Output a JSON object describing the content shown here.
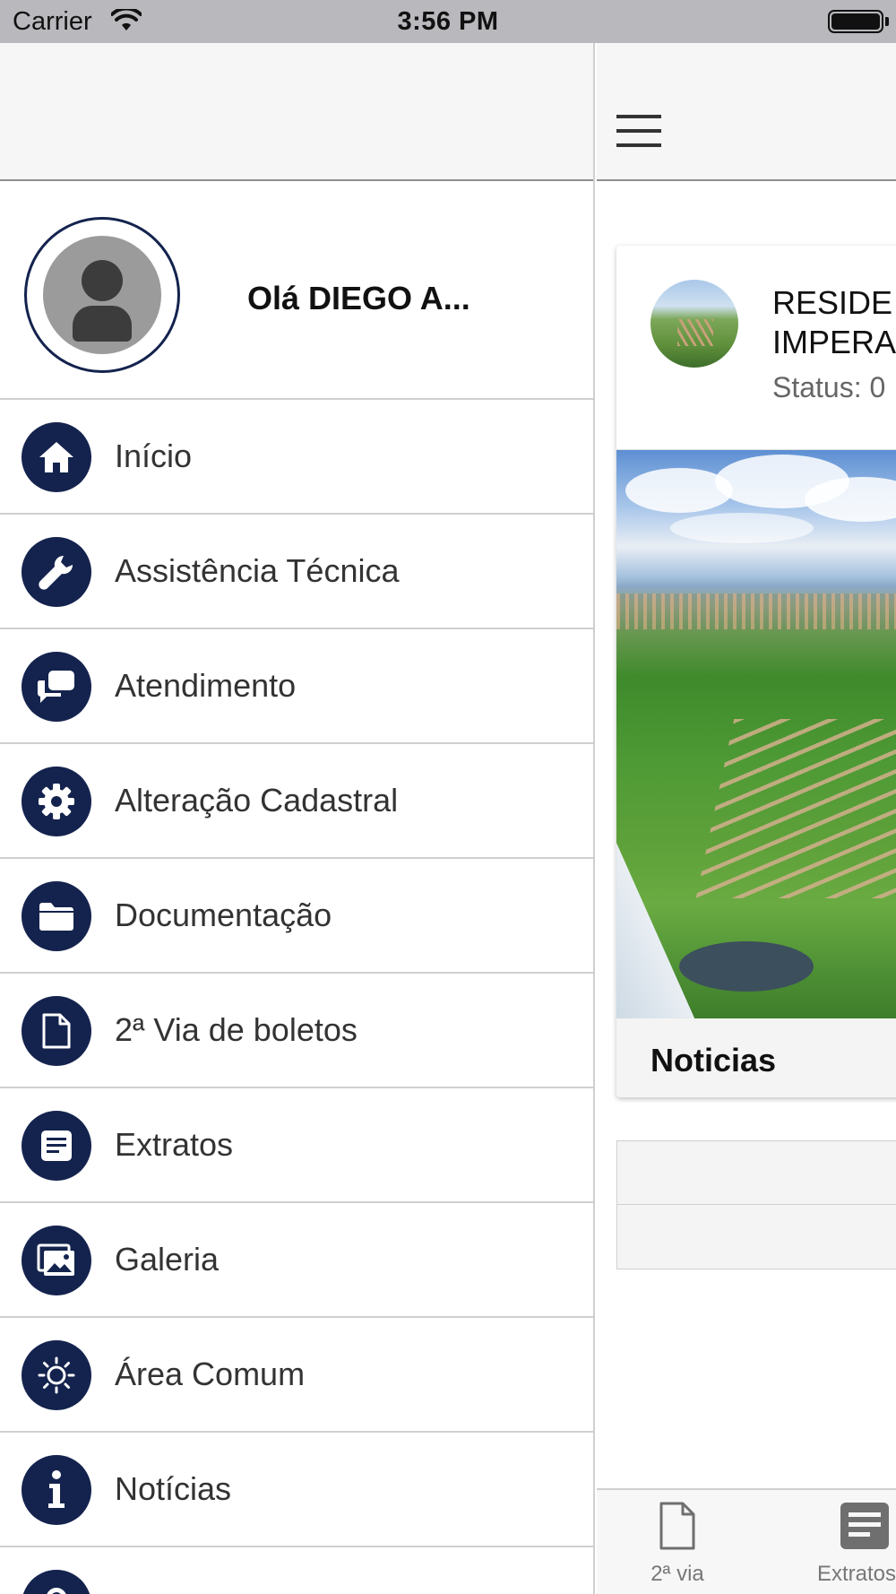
{
  "status_bar": {
    "carrier": "Carrier",
    "time": "3:56 PM"
  },
  "drawer": {
    "greeting": "Olá DIEGO A...",
    "items": [
      {
        "label": "Início",
        "icon": "home-icon"
      },
      {
        "label": "Assistência Técnica",
        "icon": "wrench-icon"
      },
      {
        "label": "Atendimento",
        "icon": "chat-icon"
      },
      {
        "label": "Alteração Cadastral",
        "icon": "gear-icon"
      },
      {
        "label": "Documentação",
        "icon": "folder-icon"
      },
      {
        "label": "2ª Via de boletos",
        "icon": "document-icon"
      },
      {
        "label": "Extratos",
        "icon": "list-icon"
      },
      {
        "label": "Galeria",
        "icon": "gallery-icon"
      },
      {
        "label": "Área Comum",
        "icon": "sun-icon"
      },
      {
        "label": "Notícias",
        "icon": "info-icon"
      }
    ]
  },
  "main": {
    "card": {
      "title_line1": "RESIDE",
      "title_line2": "IMPERA",
      "status": "Status: 0",
      "footer": "Noticias"
    },
    "tabs": [
      {
        "label": "2ª via",
        "icon": "document-icon"
      },
      {
        "label": "Extratos",
        "icon": "list-icon"
      }
    ]
  },
  "colors": {
    "accent": "#14234e",
    "header_bg": "#f6f6f6",
    "status_bar_bg": "#b9b8bd"
  }
}
